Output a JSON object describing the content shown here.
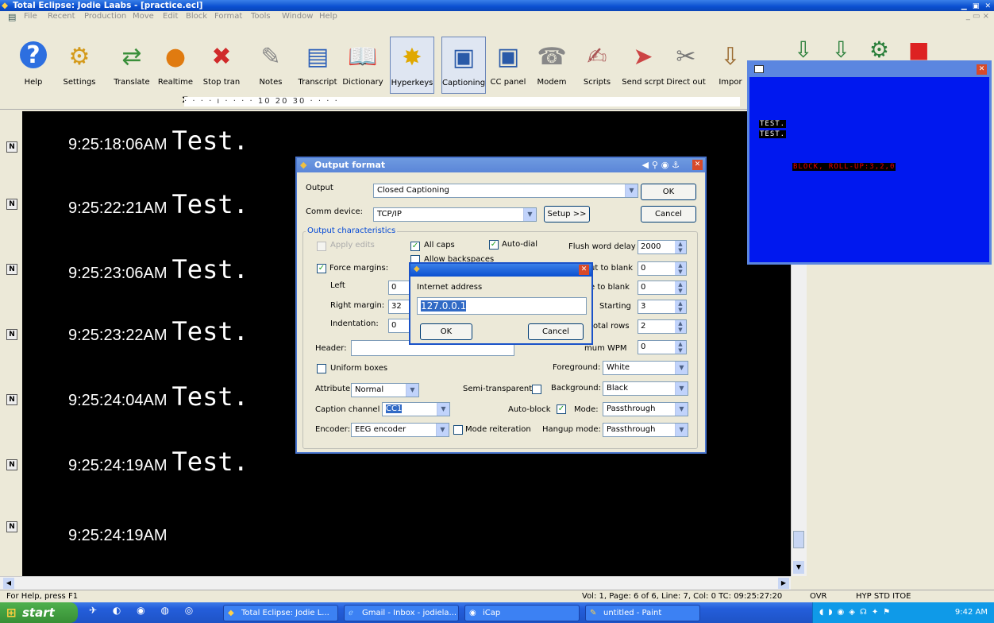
{
  "window": {
    "title": "Total Eclipse: Jodie Laabs - [practice.ecl]"
  },
  "menu": [
    "File",
    "Recent",
    "Production",
    "Move",
    "Edit",
    "Block",
    "Format",
    "Tools",
    "Window",
    "Help"
  ],
  "toolbar": [
    {
      "label": "Help",
      "icon": "help-icon",
      "glyph": "?"
    },
    {
      "label": "Settings",
      "icon": "gears-icon",
      "glyph": "⚙"
    },
    {
      "label": "Translate",
      "icon": "translate-icon",
      "glyph": "⇄"
    },
    {
      "label": "Realtime",
      "icon": "realtime-icon",
      "glyph": "●"
    },
    {
      "label": "Stop tran",
      "icon": "stop-translate-icon",
      "glyph": "✖"
    },
    {
      "label": "Notes",
      "icon": "notes-icon",
      "glyph": "✎"
    },
    {
      "label": "Transcript",
      "icon": "transcript-icon",
      "glyph": "▤"
    },
    {
      "label": "Dictionary",
      "icon": "dictionary-icon",
      "glyph": "📖"
    },
    {
      "label": "Hyperkeys",
      "icon": "hyperkeys-icon",
      "glyph": "✸"
    },
    {
      "label": "Captioning",
      "icon": "captioning-icon",
      "glyph": "▣"
    },
    {
      "label": "CC panel",
      "icon": "cc-panel-icon",
      "glyph": "▣"
    },
    {
      "label": "Modem",
      "icon": "modem-icon",
      "glyph": "☎"
    },
    {
      "label": "Scripts",
      "icon": "scripts-icon",
      "glyph": "✍"
    },
    {
      "label": "Send scrpt",
      "icon": "send-script-icon",
      "glyph": "➤"
    },
    {
      "label": "Direct out",
      "icon": "direct-out-icon",
      "glyph": "✂"
    },
    {
      "label": "Impor",
      "icon": "import-icon",
      "glyph": "⇩"
    }
  ],
  "ruler": {
    "marks": "10 20 30"
  },
  "transcript": [
    {
      "time": "9:25:18:06AM",
      "text": "Test."
    },
    {
      "time": "9:25:22:21AM",
      "text": "Test."
    },
    {
      "time": "9:25:23:06AM",
      "text": "Test."
    },
    {
      "time": "9:25:23:22AM",
      "text": "Test."
    },
    {
      "time": "9:25:24:04AM",
      "text": "Test."
    },
    {
      "time": "9:25:24:19AM",
      "text": "Test."
    },
    {
      "time": "9:25:24:19AM",
      "text": ""
    }
  ],
  "gutter_badge": "N",
  "cc_window": {
    "lines": [
      "TEST.",
      "TEST."
    ],
    "status": "BLOCK, ROLL-UP:3,2,0"
  },
  "output_dialog": {
    "title": "Output format",
    "output_label": "Output",
    "output_value": "Closed Captioning",
    "comm_label": "Comm device:",
    "comm_value": "TCP/IP",
    "setup_button": "Setup >>",
    "ok_button": "OK",
    "cancel_button": "Cancel",
    "characteristics_label": "Output characteristics",
    "apply_edits": "Apply edits",
    "all_caps": "All caps",
    "auto_dial": "Auto-dial",
    "flush_word_delay_label": "Flush word delay",
    "flush_word_delay": "2000",
    "allow_backspaces": "Allow backspaces",
    "force_margins": "Force margins:",
    "timeout_blank_label": "ut to blank",
    "timeout_blank": "0",
    "left_label": "Left",
    "left_value": "0",
    "pause_blank_label": "e to blank",
    "pause_blank": "0",
    "right_margin_label": "Right margin:",
    "right_margin": "32",
    "starting_label": "Starting",
    "starting": "3",
    "indentation_label": "Indentation:",
    "indentation": "0",
    "total_rows_label": "otal rows",
    "total_rows": "2",
    "header_label": "Header:",
    "header_value": "",
    "max_wpm_label": "mum WPM",
    "max_wpm": "0",
    "uniform_boxes": "Uniform boxes",
    "foreground_label": "Foreground:",
    "foreground": "White",
    "attribute_label": "Attribute",
    "attribute": "Normal",
    "semi_transparent": "Semi-transparent",
    "background_label": "Background:",
    "background": "Black",
    "caption_channel_label": "Caption channel",
    "caption_channel": "CC1",
    "auto_block": "Auto-block",
    "mode_label": "Mode:",
    "mode": "Passthrough",
    "encoder_label": "Encoder:",
    "encoder": "EEG encoder",
    "mode_reiteration": "Mode reiteration",
    "hangup_label": "Hangup mode:",
    "hangup": "Passthrough"
  },
  "ip_dialog": {
    "label": "Internet address",
    "value": "127.0.0.1",
    "ok": "OK",
    "cancel": "Cancel"
  },
  "status": {
    "help": "For Help, press F1",
    "position": "Vol: 1, Page: 6 of 6, Line: 7, Col: 0 TC: 09:25:27:20",
    "ovr": "OVR",
    "modes": "HYP STD ITOE"
  },
  "taskbar": {
    "start": "start",
    "tasks": [
      "Total Eclipse: Jodie L...",
      "Gmail - Inbox - jodiela...",
      "iCap",
      "untitled - Paint"
    ],
    "clock": "9:42 AM"
  }
}
